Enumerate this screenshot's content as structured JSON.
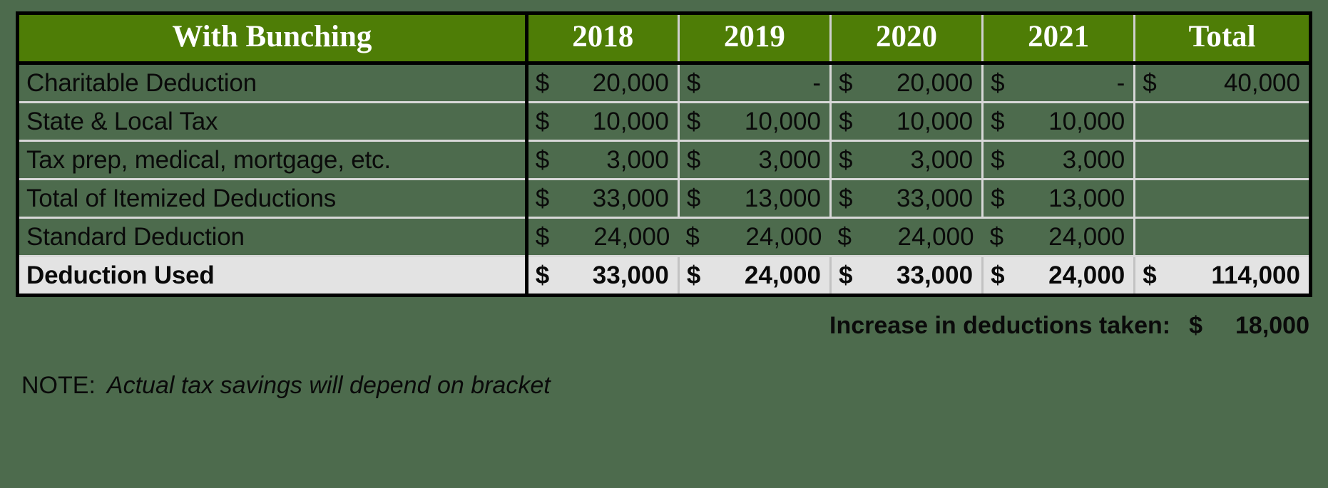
{
  "page": {
    "background_color": "#4d6b4d",
    "header_color": "#4e7d06",
    "highlight_row_color": "#e3e3e3",
    "gridline_color": "#d8d8d8",
    "border_color": "#000000",
    "header_text_color": "#ffffff",
    "body_text_color": "#0a0a0a"
  },
  "table": {
    "header": {
      "label": "With Bunching",
      "years": [
        "2018",
        "2019",
        "2020",
        "2021"
      ],
      "total": "Total"
    },
    "rows": [
      {
        "label": "Charitable Deduction",
        "cells": [
          {
            "sym": "$",
            "amt": "20,000"
          },
          {
            "sym": "$",
            "amt": "-"
          },
          {
            "sym": "$",
            "amt": "20,000"
          },
          {
            "sym": "$",
            "amt": "-"
          }
        ],
        "total": {
          "sym": "$",
          "amt": "40,000"
        }
      },
      {
        "label": "State & Local Tax",
        "cells": [
          {
            "sym": "$",
            "amt": "10,000"
          },
          {
            "sym": "$",
            "amt": "10,000"
          },
          {
            "sym": "$",
            "amt": "10,000"
          },
          {
            "sym": "$",
            "amt": "10,000"
          }
        ],
        "total": {
          "sym": "",
          "amt": ""
        }
      },
      {
        "label": "Tax prep, medical, mortgage, etc.",
        "cells": [
          {
            "sym": "$",
            "amt": "3,000"
          },
          {
            "sym": "$",
            "amt": "3,000"
          },
          {
            "sym": "$",
            "amt": "3,000"
          },
          {
            "sym": "$",
            "amt": "3,000"
          }
        ],
        "total": {
          "sym": "",
          "amt": ""
        }
      },
      {
        "label": "Total of Itemized Deductions",
        "cells": [
          {
            "sym": "$",
            "amt": "33,000"
          },
          {
            "sym": "$",
            "amt": "13,000"
          },
          {
            "sym": "$",
            "amt": "33,000"
          },
          {
            "sym": "$",
            "amt": "13,000"
          }
        ],
        "total": {
          "sym": "",
          "amt": ""
        }
      },
      {
        "label": "Standard Deduction",
        "cells": [
          {
            "sym": "$",
            "amt": "24,000"
          },
          {
            "sym": "$",
            "amt": "24,000"
          },
          {
            "sym": "$",
            "amt": "24,000"
          },
          {
            "sym": "$",
            "amt": "24,000"
          }
        ],
        "total": {
          "sym": "",
          "amt": ""
        }
      },
      {
        "label": "Deduction Used",
        "cells": [
          {
            "sym": "$",
            "amt": "33,000"
          },
          {
            "sym": "$",
            "amt": "24,000"
          },
          {
            "sym": "$",
            "amt": "33,000"
          },
          {
            "sym": "$",
            "amt": "24,000"
          }
        ],
        "total": {
          "sym": "$",
          "amt": "114,000"
        }
      }
    ]
  },
  "footer": {
    "increase_label": "Increase in deductions taken:",
    "increase_symbol": "$",
    "increase_amount": "18,000",
    "note_prefix": "NOTE:",
    "note_text": "Actual tax savings will depend on bracket"
  }
}
